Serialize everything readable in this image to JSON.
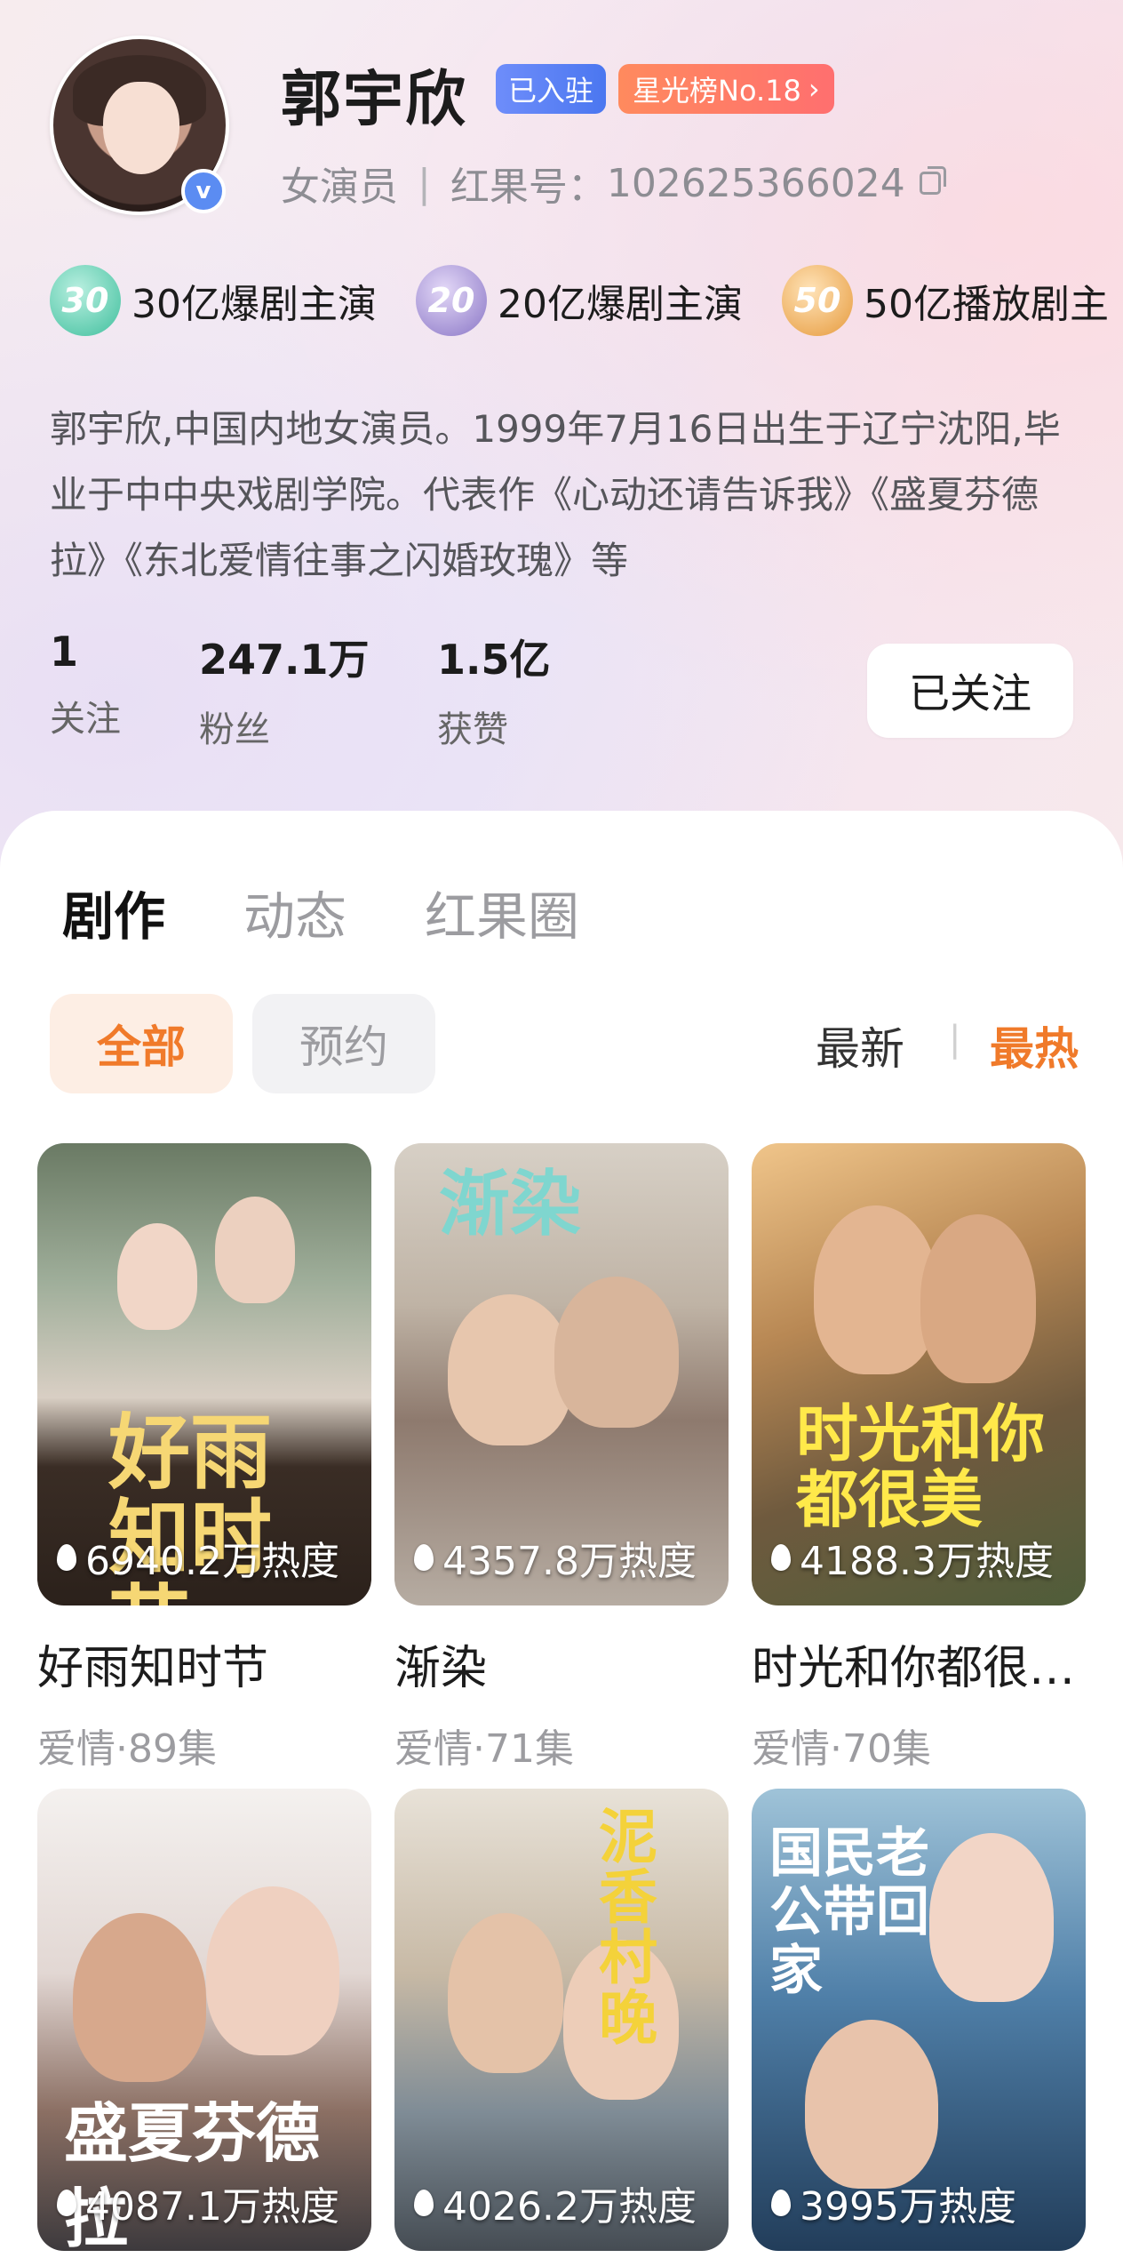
{
  "profile": {
    "name": "郭宇欣",
    "badge_joined": "已入驻",
    "badge_rank": "星光榜No.18",
    "role": "女演员",
    "id_label": "红果号：",
    "id_value": "102625366024",
    "verified_mark": "v"
  },
  "honors": [
    {
      "badge": "30",
      "label": "30亿爆剧主演"
    },
    {
      "badge": "20",
      "label": "20亿爆剧主演"
    },
    {
      "badge": "50",
      "label": "50亿播放剧主"
    }
  ],
  "bio": "郭宇欣,中国内地女演员。1999年7月16日出生于辽宁沈阳,毕业于中中央戏剧学院。代表作《心动还请告诉我》《盛夏芬德拉》《东北爱情往事之闪婚玫瑰》等",
  "stats": [
    {
      "value": "1",
      "label": "关注"
    },
    {
      "value": "247.1万",
      "label": "粉丝"
    },
    {
      "value": "1.5亿",
      "label": "获赞"
    }
  ],
  "follow_button": "已关注",
  "tabs": [
    "剧作",
    "动态",
    "红果圈"
  ],
  "filters": {
    "all": "全部",
    "reserve": "预约"
  },
  "sort": {
    "newest": "最新",
    "hottest": "最热"
  },
  "dramas": [
    {
      "title": "好雨知时节",
      "meta": "爱情·89集",
      "heat": "6940.2万热度",
      "poster_text": "好雨知时节"
    },
    {
      "title": "渐染",
      "meta": "爱情·71集",
      "heat": "4357.8万热度",
      "poster_text": "渐染"
    },
    {
      "title": "时光和你都很…",
      "meta": "爱情·70集",
      "heat": "4188.3万热度",
      "poster_text": "时光和你都很美"
    },
    {
      "title": "",
      "meta": "",
      "heat": "4087.1万热度",
      "poster_text": "盛夏芬德拉"
    },
    {
      "title": "",
      "meta": "",
      "heat": "4026.2万热度",
      "poster_text": "泥香村晚"
    },
    {
      "title": "",
      "meta": "",
      "heat": "3995万热度",
      "poster_text": "国民老公带回家"
    }
  ],
  "colors": {
    "accent": "#f07a2a",
    "verified": "#5b8cf2",
    "rank_badge": "#ff7a62"
  }
}
